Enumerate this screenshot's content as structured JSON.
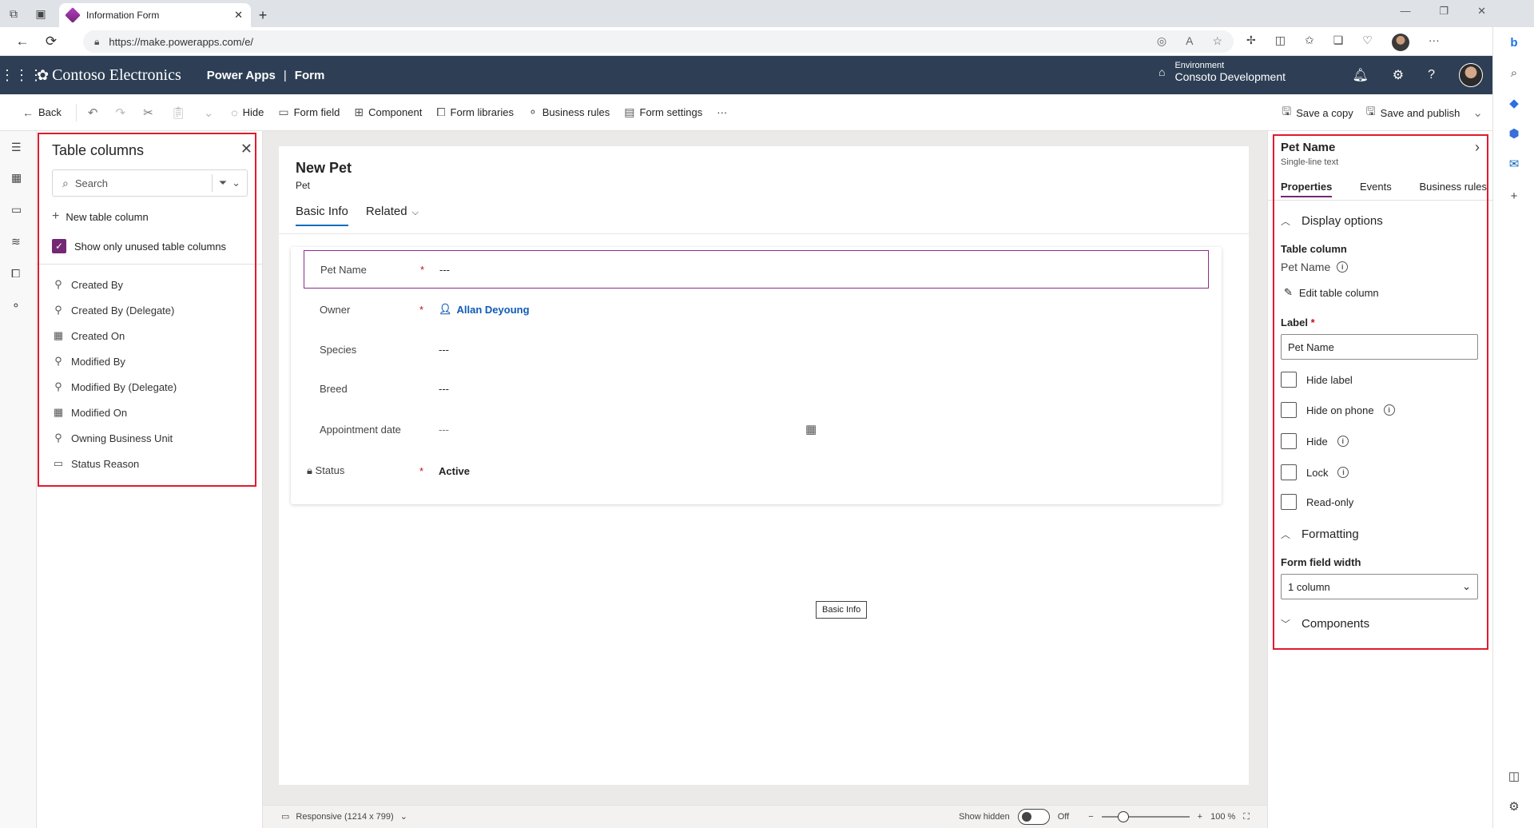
{
  "browser": {
    "tab_title": "Information Form",
    "url": "https://make.powerapps.com/e/"
  },
  "header": {
    "brand": "Contoso Electronics",
    "app": "Power Apps",
    "separator": "|",
    "page": "Form",
    "env_label": "Environment",
    "env_value": "Consoto Development"
  },
  "commandbar": {
    "back": "Back",
    "hide": "Hide",
    "form_field": "Form field",
    "component": "Component",
    "form_libraries": "Form libraries",
    "business_rules": "Business rules",
    "form_settings": "Form settings",
    "more": "···",
    "save_copy": "Save a copy",
    "save_publish": "Save and publish"
  },
  "table_columns": {
    "title": "Table columns",
    "search_placeholder": "Search",
    "new_column": "New table column",
    "show_unused": "Show only unused table columns",
    "show_unused_checked": true,
    "items": [
      {
        "label": "Created By",
        "icon": "lookup-icon"
      },
      {
        "label": "Created By (Delegate)",
        "icon": "lookup-icon"
      },
      {
        "label": "Created On",
        "icon": "calendar-icon"
      },
      {
        "label": "Modified By",
        "icon": "lookup-icon"
      },
      {
        "label": "Modified By (Delegate)",
        "icon": "lookup-icon"
      },
      {
        "label": "Modified On",
        "icon": "calendar-icon"
      },
      {
        "label": "Owning Business Unit",
        "icon": "lookup-icon"
      },
      {
        "label": "Status Reason",
        "icon": "option-set-icon"
      }
    ]
  },
  "form": {
    "title": "New Pet",
    "subtitle": "Pet",
    "tabs": [
      "Basic Info",
      "Related"
    ],
    "fields": [
      {
        "label": "Pet Name",
        "required": "*",
        "value": "---"
      },
      {
        "label": "Owner",
        "required": "*",
        "value": "Allan Deyoung"
      },
      {
        "label": "Species",
        "required": "",
        "value": "---"
      },
      {
        "label": "Breed",
        "required": "",
        "value": "---"
      },
      {
        "label": "Appointment date",
        "required": "",
        "value": "---"
      },
      {
        "label": "Status",
        "required": "*",
        "value": "Active"
      }
    ],
    "tooltip": "Basic Info"
  },
  "statusbar": {
    "responsive": "Responsive (1214 x 799)",
    "show_hidden": "Show hidden",
    "toggle_state": "Off",
    "zoom_minus": "−",
    "zoom_plus": "+",
    "zoom_level": "100 %",
    "zoom_fraction": 0.2
  },
  "properties": {
    "title": "Pet Name",
    "subtitle": "Single-line text",
    "tabs": [
      "Properties",
      "Events",
      "Business rules"
    ],
    "display_options": "Display options",
    "table_column_label": "Table column",
    "table_column_value": "Pet Name",
    "edit_column": "Edit table column",
    "label_caption": "Label",
    "label_required": "*",
    "label_value": "Pet Name",
    "checks": [
      "Hide label",
      "Hide on phone",
      "Hide",
      "Lock",
      "Read-only"
    ],
    "formatting": "Formatting",
    "form_field_width": "Form field width",
    "width_value": "1 column",
    "components": "Components"
  },
  "colors": {
    "header_bg": "#2e3f55",
    "accent": "#742774",
    "highlight": "#e01b2f",
    "link": "#0f5bb5"
  }
}
